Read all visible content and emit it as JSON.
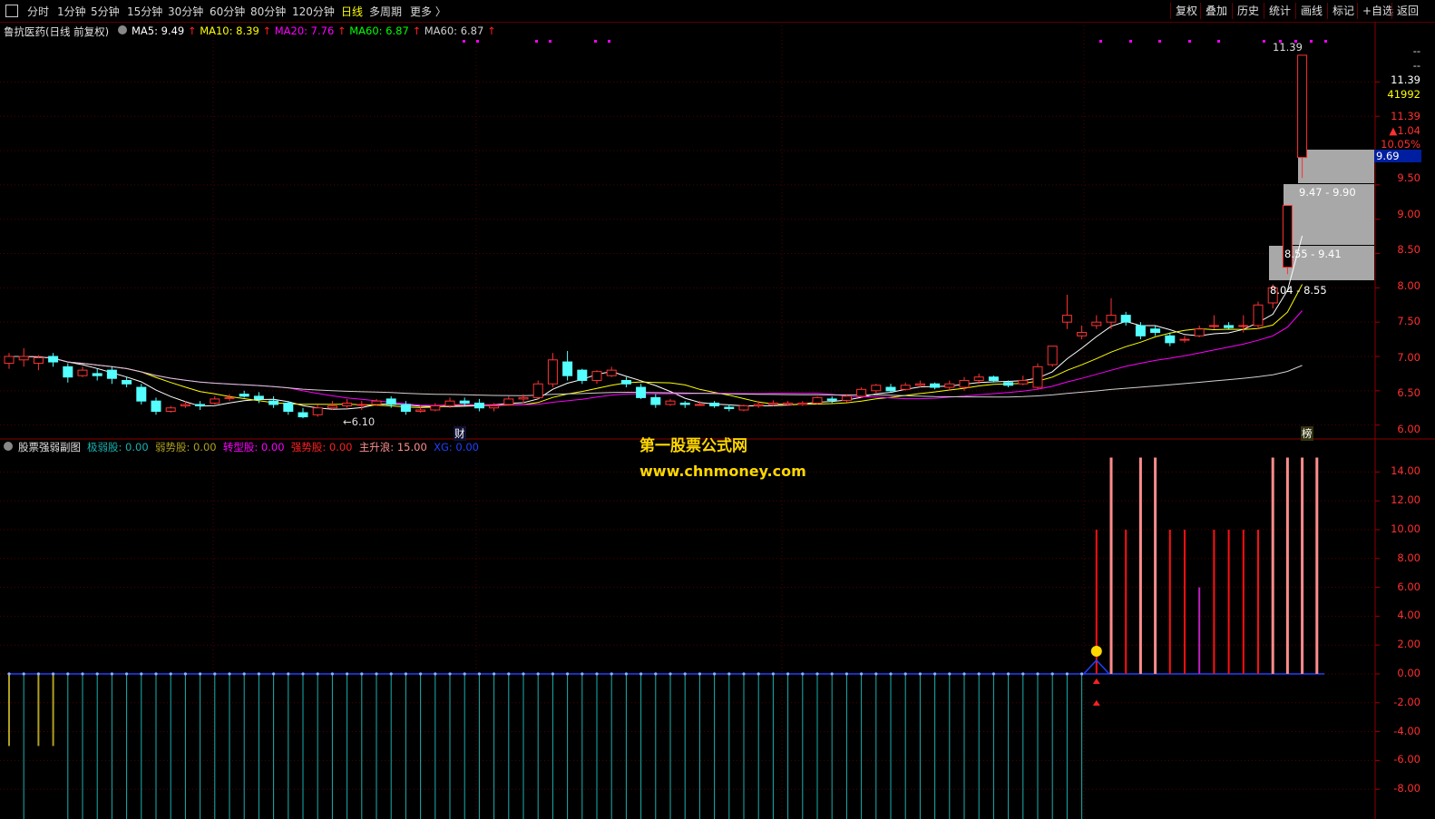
{
  "periods": [
    "分时",
    "1分钟",
    "5分钟",
    "15分钟",
    "30分钟",
    "60分钟",
    "80分钟",
    "120分钟",
    "日线",
    "多周期",
    "更多 〉"
  ],
  "active_period": "日线",
  "right_buttons": [
    "复权",
    "叠加",
    "历史",
    "统计",
    "画线",
    "标记",
    "+自选",
    "返回"
  ],
  "main_panel": {
    "title": "鲁抗医药(日线 前复权)",
    "ma": [
      {
        "label": "MA5: 9.49",
        "color": "#ffffff"
      },
      {
        "label": "MA10: 8.39",
        "color": "#ffff00"
      },
      {
        "label": "MA20: 7.76",
        "color": "#ff00ff"
      },
      {
        "label": "MA60: 6.87",
        "color": "#00ff00"
      },
      {
        "label": "MA60: 6.87",
        "color": "#d0d0d0"
      }
    ],
    "annotations": {
      "high": "11.39",
      "low": "←6.10",
      "cai": "财",
      "bang": "榜"
    },
    "right_info": {
      "dash1": "--",
      "dash2": "--",
      "price": "11.39",
      "volume": "41992",
      "price2": "11.39",
      "change": "▲1.04",
      "pct": "10.05%",
      "cur": "9.69"
    },
    "price_axis": [
      "9.50",
      "9.00",
      "8.50",
      "8.00",
      "7.50",
      "7.00",
      "6.50",
      "6.00"
    ],
    "chips": [
      "9.47 - 9.90",
      "8.55 - 9.41",
      "8.04 - 8.55"
    ]
  },
  "sub_panel": {
    "title": "股票强弱副图",
    "indicators": [
      {
        "label": "极弱股: 0.00",
        "color": "#1ab0b0"
      },
      {
        "label": "弱势股: 0.00",
        "color": "#b0a020"
      },
      {
        "label": "转型股: 0.00",
        "color": "#ff00ff"
      },
      {
        "label": "强势股: 0.00",
        "color": "#ff2020"
      },
      {
        "label": "主升浪: 15.00",
        "color": "#ff9090"
      },
      {
        "label": "XG: 0.00",
        "color": "#2040ff"
      }
    ],
    "axis": [
      "14.00",
      "12.00",
      "10.00",
      "8.00",
      "6.00",
      "4.00",
      "2.00",
      "0.00",
      "-2.00",
      "-4.00",
      "-6.00",
      "-8.00"
    ]
  },
  "watermark": {
    "line1": "第一股票公式网",
    "line2": "www.chnmoney.com"
  },
  "chart_data": {
    "type": "candlestick",
    "ylim": [
      5.85,
      11.6
    ],
    "candles": [
      [
        6.9,
        7.0,
        6.82,
        7.05
      ],
      [
        6.95,
        7.0,
        6.85,
        7.12
      ],
      [
        6.9,
        6.98,
        6.8,
        7.02
      ],
      [
        7.0,
        6.92,
        6.85,
        7.05
      ],
      [
        6.85,
        6.7,
        6.62,
        6.9
      ],
      [
        6.72,
        6.8,
        6.7,
        6.85
      ],
      [
        6.75,
        6.72,
        6.65,
        6.82
      ],
      [
        6.8,
        6.68,
        6.6,
        6.85
      ],
      [
        6.65,
        6.6,
        6.55,
        6.7
      ],
      [
        6.55,
        6.35,
        6.3,
        6.6
      ],
      [
        6.35,
        6.2,
        6.15,
        6.4
      ],
      [
        6.2,
        6.25,
        6.18,
        6.28
      ],
      [
        6.28,
        6.3,
        6.25,
        6.35
      ],
      [
        6.3,
        6.28,
        6.22,
        6.35
      ],
      [
        6.32,
        6.38,
        6.3,
        6.42
      ],
      [
        6.4,
        6.4,
        6.35,
        6.45
      ],
      [
        6.45,
        6.42,
        6.4,
        6.5
      ],
      [
        6.42,
        6.38,
        6.32,
        6.48
      ],
      [
        6.35,
        6.3,
        6.25,
        6.42
      ],
      [
        6.32,
        6.2,
        6.15,
        6.35
      ],
      [
        6.18,
        6.12,
        6.1,
        6.25
      ],
      [
        6.15,
        6.25,
        6.12,
        6.3
      ],
      [
        6.25,
        6.28,
        6.22,
        6.35
      ],
      [
        6.28,
        6.32,
        6.25,
        6.38
      ],
      [
        6.3,
        6.3,
        6.22,
        6.35
      ],
      [
        6.3,
        6.35,
        6.28,
        6.38
      ],
      [
        6.38,
        6.3,
        6.25,
        6.42
      ],
      [
        6.3,
        6.2,
        6.15,
        6.35
      ],
      [
        6.2,
        6.22,
        6.18,
        6.28
      ],
      [
        6.22,
        6.28,
        6.2,
        6.32
      ],
      [
        6.28,
        6.35,
        6.25,
        6.4
      ],
      [
        6.35,
        6.32,
        6.28,
        6.4
      ],
      [
        6.32,
        6.25,
        6.2,
        6.38
      ],
      [
        6.25,
        6.28,
        6.2,
        6.32
      ],
      [
        6.3,
        6.38,
        6.28,
        6.42
      ],
      [
        6.38,
        6.4,
        6.32,
        6.45
      ],
      [
        6.4,
        6.6,
        6.38,
        6.65
      ],
      [
        6.6,
        6.95,
        6.55,
        7.05
      ],
      [
        6.92,
        6.72,
        6.65,
        7.08
      ],
      [
        6.8,
        6.65,
        6.6,
        6.82
      ],
      [
        6.65,
        6.78,
        6.6,
        6.8
      ],
      [
        6.72,
        6.8,
        6.7,
        6.85
      ],
      [
        6.65,
        6.6,
        6.55,
        6.7
      ],
      [
        6.55,
        6.4,
        6.38,
        6.6
      ],
      [
        6.4,
        6.3,
        6.25,
        6.45
      ],
      [
        6.3,
        6.35,
        6.28,
        6.38
      ],
      [
        6.32,
        6.3,
        6.25,
        6.35
      ],
      [
        6.3,
        6.3,
        6.28,
        6.35
      ],
      [
        6.32,
        6.28,
        6.25,
        6.35
      ],
      [
        6.26,
        6.24,
        6.2,
        6.3
      ],
      [
        6.22,
        6.28,
        6.2,
        6.3
      ],
      [
        6.28,
        6.3,
        6.25,
        6.35
      ],
      [
        6.3,
        6.32,
        6.28,
        6.36
      ],
      [
        6.3,
        6.32,
        6.28,
        6.35
      ],
      [
        6.3,
        6.32,
        6.28,
        6.35
      ],
      [
        6.32,
        6.4,
        6.3,
        6.42
      ],
      [
        6.38,
        6.36,
        6.32,
        6.42
      ],
      [
        6.36,
        6.42,
        6.33,
        6.45
      ],
      [
        6.42,
        6.52,
        6.4,
        6.55
      ],
      [
        6.5,
        6.58,
        6.45,
        6.6
      ],
      [
        6.55,
        6.5,
        6.48,
        6.6
      ],
      [
        6.52,
        6.58,
        6.5,
        6.62
      ],
      [
        6.58,
        6.6,
        6.55,
        6.65
      ],
      [
        6.6,
        6.55,
        6.52,
        6.62
      ],
      [
        6.55,
        6.6,
        6.5,
        6.65
      ],
      [
        6.55,
        6.65,
        6.5,
        6.7
      ],
      [
        6.65,
        6.7,
        6.6,
        6.75
      ],
      [
        6.7,
        6.65,
        6.62,
        6.72
      ],
      [
        6.62,
        6.58,
        6.55,
        6.65
      ],
      [
        6.6,
        6.65,
        6.58,
        6.72
      ],
      [
        6.55,
        6.85,
        6.52,
        6.9
      ],
      [
        6.88,
        7.15,
        6.85,
        7.15
      ],
      [
        7.5,
        7.6,
        7.4,
        7.9
      ],
      [
        7.3,
        7.35,
        7.25,
        7.45
      ],
      [
        7.45,
        7.5,
        7.4,
        7.6
      ],
      [
        7.5,
        7.6,
        7.4,
        7.85
      ],
      [
        7.6,
        7.5,
        7.45,
        7.65
      ],
      [
        7.45,
        7.3,
        7.25,
        7.5
      ],
      [
        7.4,
        7.35,
        7.3,
        7.45
      ],
      [
        7.3,
        7.2,
        7.15,
        7.35
      ],
      [
        7.25,
        7.25,
        7.2,
        7.3
      ],
      [
        7.3,
        7.4,
        7.28,
        7.45
      ],
      [
        7.45,
        7.45,
        7.4,
        7.6
      ],
      [
        7.45,
        7.42,
        7.4,
        7.5
      ],
      [
        7.45,
        7.45,
        7.35,
        7.6
      ],
      [
        7.45,
        7.75,
        7.4,
        7.8
      ],
      [
        7.78,
        8.0,
        7.7,
        8.05
      ],
      [
        8.3,
        9.2,
        8.2,
        9.2
      ],
      [
        9.9,
        11.39,
        9.6,
        11.39
      ]
    ],
    "sub_values": [
      -5,
      -9,
      -5,
      -5,
      -9,
      -9,
      -9,
      -9,
      -9,
      -9,
      -9,
      -9,
      -9,
      -9,
      -9,
      -9,
      -9,
      -9,
      -9,
      -9,
      -9,
      -9,
      -9,
      -9,
      -9,
      -9,
      -9,
      -9,
      -9,
      -9,
      -9,
      -9,
      -9,
      -9,
      -9,
      -9,
      -9,
      -9,
      -9,
      -9,
      -9,
      -9,
      -9,
      -9,
      -9,
      -9,
      -9,
      -9,
      -9,
      -9,
      -9,
      -9,
      -9,
      -9,
      -9,
      -9,
      -9,
      -9,
      -9,
      -9,
      -9,
      -9,
      -9,
      -9,
      -9,
      -9,
      -9,
      -9,
      -9,
      -9,
      -9,
      -9,
      -9,
      -9,
      10,
      15,
      10,
      15,
      15,
      10,
      10,
      6,
      10,
      10,
      10,
      10,
      15,
      15,
      15,
      15
    ]
  }
}
